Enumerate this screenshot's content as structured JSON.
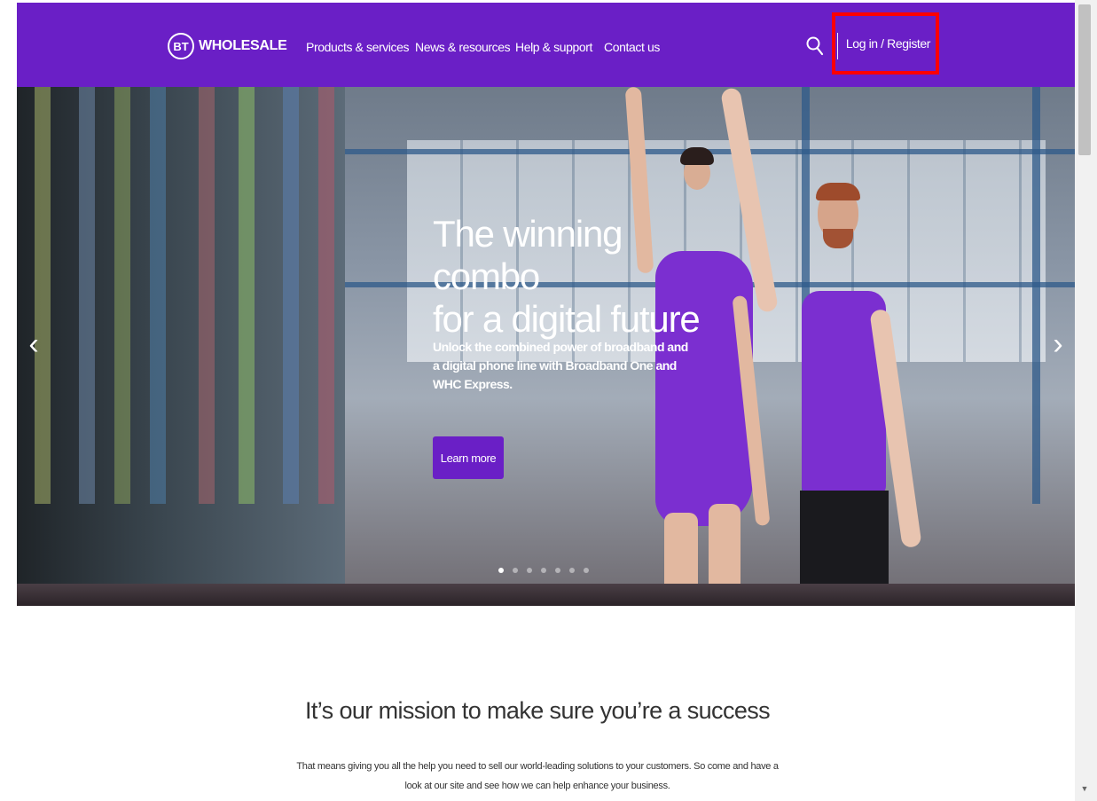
{
  "header": {
    "logo_bt": "BT",
    "logo_text": "WHOLESALE",
    "nav": [
      {
        "label": "Products & services"
      },
      {
        "label": "News & resources"
      },
      {
        "label": "Help & support"
      },
      {
        "label": "Contact us"
      }
    ],
    "search_icon": "search-icon",
    "login_label": "Log in / Register"
  },
  "hero": {
    "title": "The winning combo\nfor a digital future",
    "subtitle": "Unlock the combined power of broadband and a digital phone line with Broadband One and WHC Express.",
    "cta_label": "Learn more",
    "prev_icon": "‹",
    "next_icon": "›",
    "slide_count": 7,
    "active_slide": 1
  },
  "mission": {
    "title": "It’s our mission to make sure you’re a success",
    "text": "That means giving you all the help you need to sell our world-leading solutions to your customers. So come and have a look at our site and see how we can help enhance your business."
  },
  "colors": {
    "brand_purple": "#6a1fc6",
    "highlight_red": "#ff0000"
  }
}
